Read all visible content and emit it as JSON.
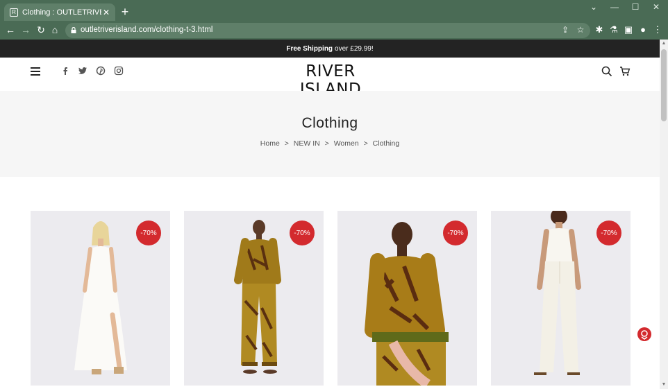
{
  "browser": {
    "tab_title": "Clothing : OUTLETRIVERISLAND.",
    "url": "outletriverisland.com/clothing-t-3.html",
    "new_tab": "+",
    "tab_close": "✕"
  },
  "promo": {
    "bold": "Free Shipping",
    "text": "over £29.99!"
  },
  "header": {
    "logo": "RIVER ISLAND",
    "social_icons": [
      "facebook-icon",
      "twitter-icon",
      "pinterest-icon",
      "instagram-icon"
    ]
  },
  "hero": {
    "title": "Clothing",
    "breadcrumb": [
      "Home",
      "NEW IN",
      "Women",
      "Clothing"
    ],
    "separator": ">"
  },
  "products": [
    {
      "badge": "-70%",
      "name_icon": "white-maxi-dress"
    },
    {
      "badge": "-70%",
      "name_icon": "printed-shirt-trousers"
    },
    {
      "badge": "-70%",
      "name_icon": "printed-shirt-closeup"
    },
    {
      "badge": "-70%",
      "name_icon": "white-cami-jeans"
    }
  ],
  "colors": {
    "chrome": "#4a6b55",
    "promo_bar": "#232323",
    "badge": "#d32a2e"
  }
}
